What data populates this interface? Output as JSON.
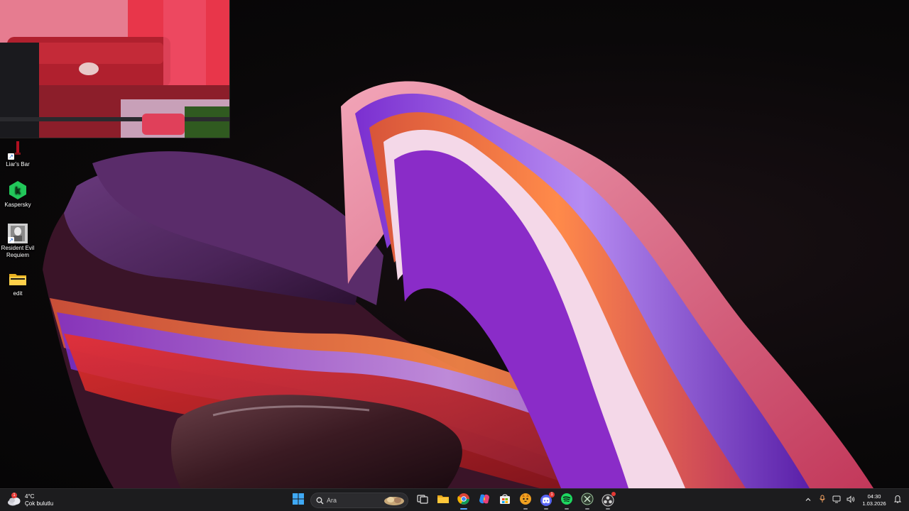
{
  "desktop": {
    "icons": [
      {
        "label": "Liar's Bar",
        "icon": "liars-bar-game-icon"
      },
      {
        "label": "Kaspersky",
        "icon": "kaspersky-k-icon"
      },
      {
        "label": "Resident Evil Requiem",
        "icon": "resident-evil-requiem-icon"
      },
      {
        "label": "edit",
        "icon": "folder-icon"
      }
    ]
  },
  "webcam": {
    "content": "webcam-overlay-red-lit-room-with-sofa"
  },
  "taskbar": {
    "weather": {
      "temperature": "4°C",
      "condition": "Çok bulutlu",
      "badge": "1",
      "icon": "cloudy-weather-icon"
    },
    "search": {
      "placeholder": "Ara"
    },
    "apps": [
      {
        "icon": "windows-start-icon"
      },
      {
        "icon": "search-icon"
      },
      {
        "icon": "task-view-icon"
      },
      {
        "icon": "file-explorer-icon"
      },
      {
        "icon": "chrome-icon"
      },
      {
        "icon": "copilot-icon"
      },
      {
        "icon": "microsoft-store-icon"
      },
      {
        "icon": "cat-app-icon"
      },
      {
        "icon": "discord-icon",
        "badge": "1"
      },
      {
        "icon": "spotify-icon"
      },
      {
        "icon": "xbox-icon"
      },
      {
        "icon": "obs-icon"
      }
    ],
    "tray": {
      "clock_time": "04:30",
      "clock_date": "1.03.2026",
      "icons": [
        "chevron-up-icon",
        "microphone-icon",
        "network-icon",
        "volume-icon",
        "notification-icon"
      ]
    },
    "colors": {
      "taskbar_bg": "#1c1c1e",
      "accent": "#4fa7ff"
    }
  }
}
